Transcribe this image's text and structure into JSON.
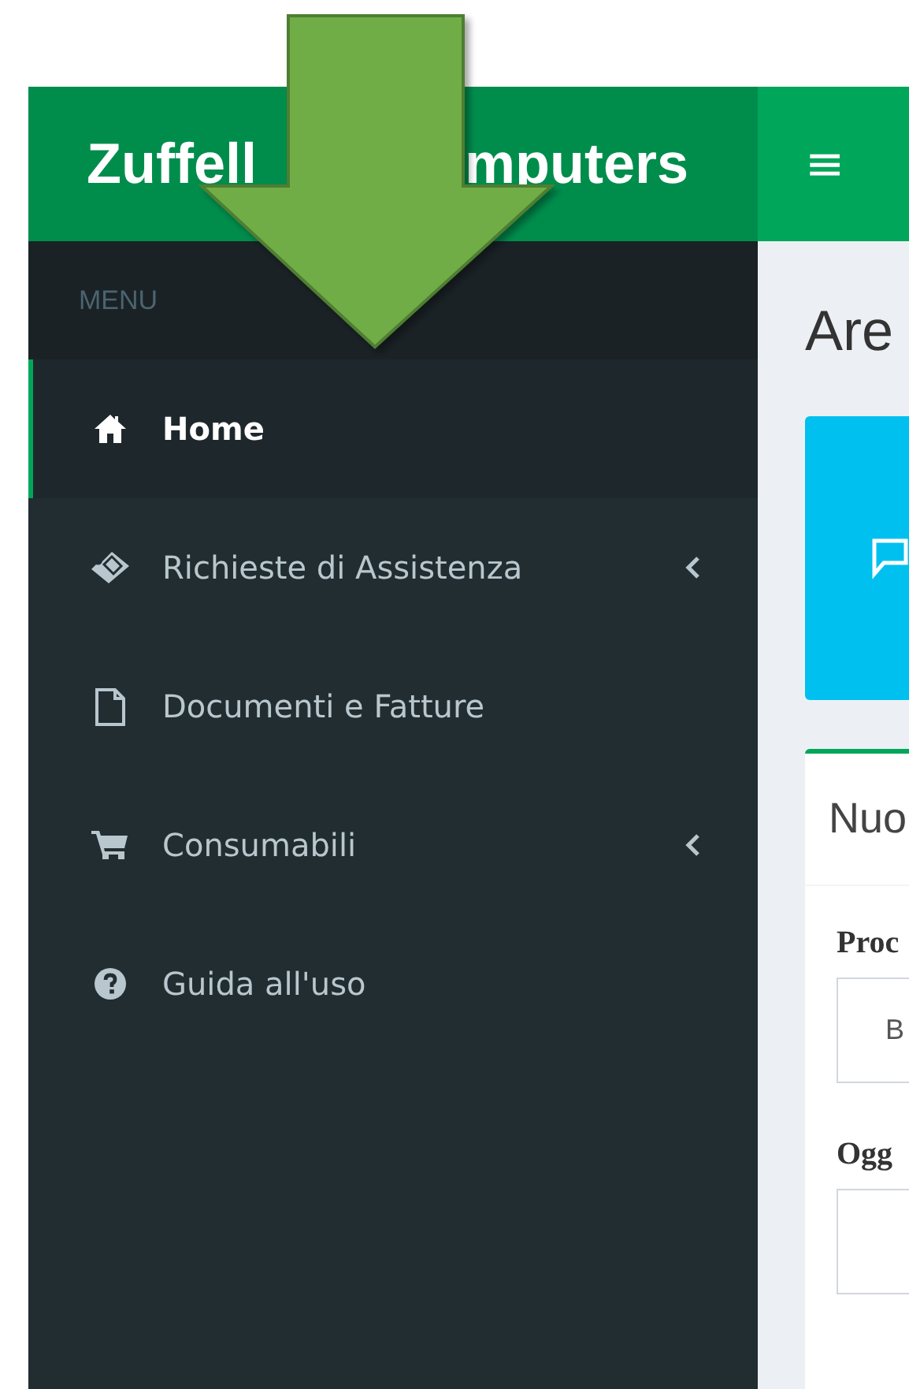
{
  "sidebar": {
    "logo_parts": [
      "Zuffell",
      "mputers"
    ],
    "header": "MENU",
    "items": [
      {
        "label": "Home",
        "selected": true,
        "submenu": false
      },
      {
        "label": "Richieste di Assistenza",
        "selected": false,
        "submenu": true
      },
      {
        "label": "Documenti e Fatture",
        "selected": false,
        "submenu": false
      },
      {
        "label": "Consumabili",
        "selected": false,
        "submenu": true
      },
      {
        "label": "Guida all'uso",
        "selected": false,
        "submenu": false
      }
    ]
  },
  "topbar": {
    "menu_toggle": "≡"
  },
  "content": {
    "title": "Are",
    "box_title": "Nuo",
    "fields": [
      {
        "label": "Proc",
        "value": "B"
      },
      {
        "label": "Ogg"
      }
    ]
  }
}
